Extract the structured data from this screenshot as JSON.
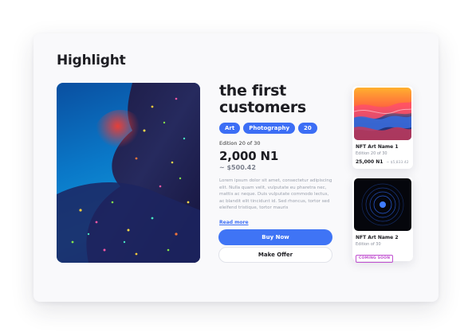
{
  "section_title": "Highlight",
  "product": {
    "title_line1": "the first",
    "title_line2": "customers",
    "tags": [
      "Art",
      "Photography",
      "20"
    ],
    "edition": "Edition 20 of 30",
    "price": "2,000 N1",
    "price_usd": "~ $500.42",
    "description": "Lorem ipsum dolor sit amet, consectetur adipiscing elit. Nulla quam velit, vulputate eu pharetra nec, mattis ac neque. Duis vulputate commodo lectus, ac blandit elit tincidunt id. Sed rhoncus, tortor sed eleifend tristique, tortor mauris",
    "read_more": "Read more",
    "buy_label": "Buy Now",
    "offer_label": "Make Offer"
  },
  "nfts": [
    {
      "name": "NFT Art Name 1",
      "edition": "Edition 20 of 30",
      "price": "25,000 N1",
      "price_usd": "~ $5,833.42"
    },
    {
      "name": "NFT Art Name 2",
      "edition": "Edition of 30",
      "badge": "COMING SOON"
    }
  ],
  "colors": {
    "accent": "#3f74f5",
    "badge": "#c04fd0"
  },
  "icons": [
    "nft-art-wave-image",
    "nft-art-circles-image",
    "hero-art-image"
  ]
}
